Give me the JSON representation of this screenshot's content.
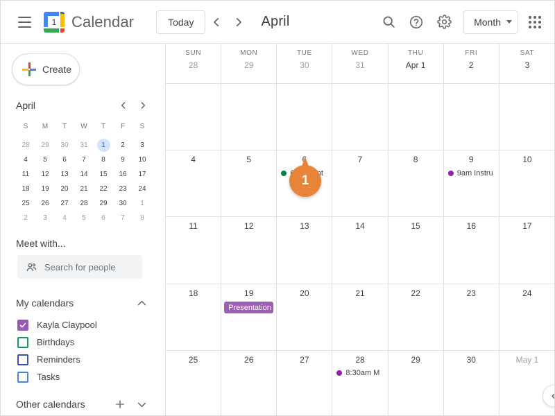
{
  "topbar": {
    "menu_icon": "hamburger-icon",
    "logo_day": "1",
    "app_title": "Calendar",
    "today_label": "Today",
    "prev_icon": "chevron-left-icon",
    "next_icon": "chevron-right-icon",
    "period_title": "April",
    "search_icon": "search-icon",
    "help_icon": "help-icon",
    "settings_icon": "gear-icon",
    "view_label": "Month",
    "view_caret_icon": "chevron-down-icon",
    "apps_icon": "apps-grid-icon"
  },
  "sidebar": {
    "create_label": "Create",
    "create_icon": "plus-icon",
    "mini_calendar": {
      "month": "April",
      "prev_icon": "chevron-left-icon",
      "next_icon": "chevron-right-icon",
      "dow": [
        "S",
        "M",
        "T",
        "W",
        "T",
        "F",
        "S"
      ],
      "weeks": [
        [
          {
            "d": "28",
            "muted": true
          },
          {
            "d": "29",
            "muted": true
          },
          {
            "d": "30",
            "muted": true
          },
          {
            "d": "31",
            "muted": true
          },
          {
            "d": "1",
            "today": true
          },
          {
            "d": "2"
          },
          {
            "d": "3"
          }
        ],
        [
          {
            "d": "4"
          },
          {
            "d": "5"
          },
          {
            "d": "6"
          },
          {
            "d": "7"
          },
          {
            "d": "8"
          },
          {
            "d": "9"
          },
          {
            "d": "10"
          }
        ],
        [
          {
            "d": "11"
          },
          {
            "d": "12"
          },
          {
            "d": "13"
          },
          {
            "d": "14"
          },
          {
            "d": "15"
          },
          {
            "d": "16"
          },
          {
            "d": "17"
          }
        ],
        [
          {
            "d": "18"
          },
          {
            "d": "19"
          },
          {
            "d": "20"
          },
          {
            "d": "21"
          },
          {
            "d": "22"
          },
          {
            "d": "23"
          },
          {
            "d": "24"
          }
        ],
        [
          {
            "d": "25"
          },
          {
            "d": "26"
          },
          {
            "d": "27"
          },
          {
            "d": "28"
          },
          {
            "d": "29"
          },
          {
            "d": "30"
          },
          {
            "d": "1",
            "muted": true
          }
        ],
        [
          {
            "d": "2",
            "muted": true
          },
          {
            "d": "3",
            "muted": true
          },
          {
            "d": "4",
            "muted": true
          },
          {
            "d": "5",
            "muted": true
          },
          {
            "d": "6",
            "muted": true
          },
          {
            "d": "7",
            "muted": true
          },
          {
            "d": "8",
            "muted": true
          }
        ]
      ]
    },
    "meet_with_label": "Meet with...",
    "people_search_placeholder": "Search for people",
    "people_icon": "people-icon",
    "my_calendars_label": "My calendars",
    "my_calendars_collapse_icon": "chevron-up-icon",
    "calendars": [
      {
        "name": "Kayla Claypool",
        "checked": true,
        "color": "#9b59b6"
      },
      {
        "name": "Birthdays",
        "checked": false,
        "color": "#0f9d58"
      },
      {
        "name": "Reminders",
        "checked": false,
        "color": "#3f51b5"
      },
      {
        "name": "Tasks",
        "checked": false,
        "color": "#4285f4"
      }
    ],
    "other_calendars_label": "Other calendars",
    "other_add_icon": "plus-icon",
    "other_expand_icon": "chevron-down-icon"
  },
  "calendar": {
    "day_headers": [
      {
        "name": "SUN",
        "num": "28",
        "muted": true
      },
      {
        "name": "MON",
        "num": "29",
        "muted": true
      },
      {
        "name": "TUE",
        "num": "30",
        "muted": true
      },
      {
        "name": "WED",
        "num": "31",
        "muted": true
      },
      {
        "name": "THU",
        "num": "Apr 1",
        "muted": false,
        "bold": true
      },
      {
        "name": "FRI",
        "num": "2",
        "muted": false
      },
      {
        "name": "SAT",
        "num": "3",
        "muted": false
      }
    ],
    "weeks": [
      [
        {
          "num": "",
          "events": []
        },
        {
          "num": "",
          "events": []
        },
        {
          "num": "",
          "events": []
        },
        {
          "num": "",
          "events": []
        },
        {
          "num": "",
          "events": []
        },
        {
          "num": "",
          "events": []
        },
        {
          "num": "",
          "events": []
        }
      ],
      [
        {
          "num": "4",
          "events": []
        },
        {
          "num": "5",
          "events": []
        },
        {
          "num": "6",
          "events": [
            {
              "style": "dot",
              "text": "6pm Dent",
              "color": "#0b8043"
            }
          ]
        },
        {
          "num": "7",
          "events": []
        },
        {
          "num": "8",
          "events": []
        },
        {
          "num": "9",
          "events": [
            {
              "style": "dot",
              "text": "9am Instru",
              "color": "#8e24aa"
            }
          ]
        },
        {
          "num": "10",
          "events": []
        }
      ],
      [
        {
          "num": "11",
          "events": []
        },
        {
          "num": "12",
          "events": []
        },
        {
          "num": "13",
          "events": []
        },
        {
          "num": "14",
          "events": []
        },
        {
          "num": "15",
          "events": []
        },
        {
          "num": "16",
          "events": []
        },
        {
          "num": "17",
          "events": []
        }
      ],
      [
        {
          "num": "18",
          "events": []
        },
        {
          "num": "19",
          "events": [
            {
              "style": "chip",
              "text": "Presentation",
              "color": "#9c5fb3"
            }
          ]
        },
        {
          "num": "20",
          "events": []
        },
        {
          "num": "21",
          "events": []
        },
        {
          "num": "22",
          "events": []
        },
        {
          "num": "23",
          "events": []
        },
        {
          "num": "24",
          "events": []
        }
      ],
      [
        {
          "num": "25",
          "events": []
        },
        {
          "num": "26",
          "events": []
        },
        {
          "num": "27",
          "events": []
        },
        {
          "num": "28",
          "events": [
            {
              "style": "dot",
              "text": "8:30am M",
              "color": "#8e24aa"
            }
          ]
        },
        {
          "num": "29",
          "events": []
        },
        {
          "num": "30",
          "events": []
        },
        {
          "num": "May 1",
          "muted": true,
          "events": []
        }
      ]
    ],
    "expander_icon": "chevron-left-icon"
  },
  "marker": {
    "number": "1",
    "color": "#e8833a"
  }
}
